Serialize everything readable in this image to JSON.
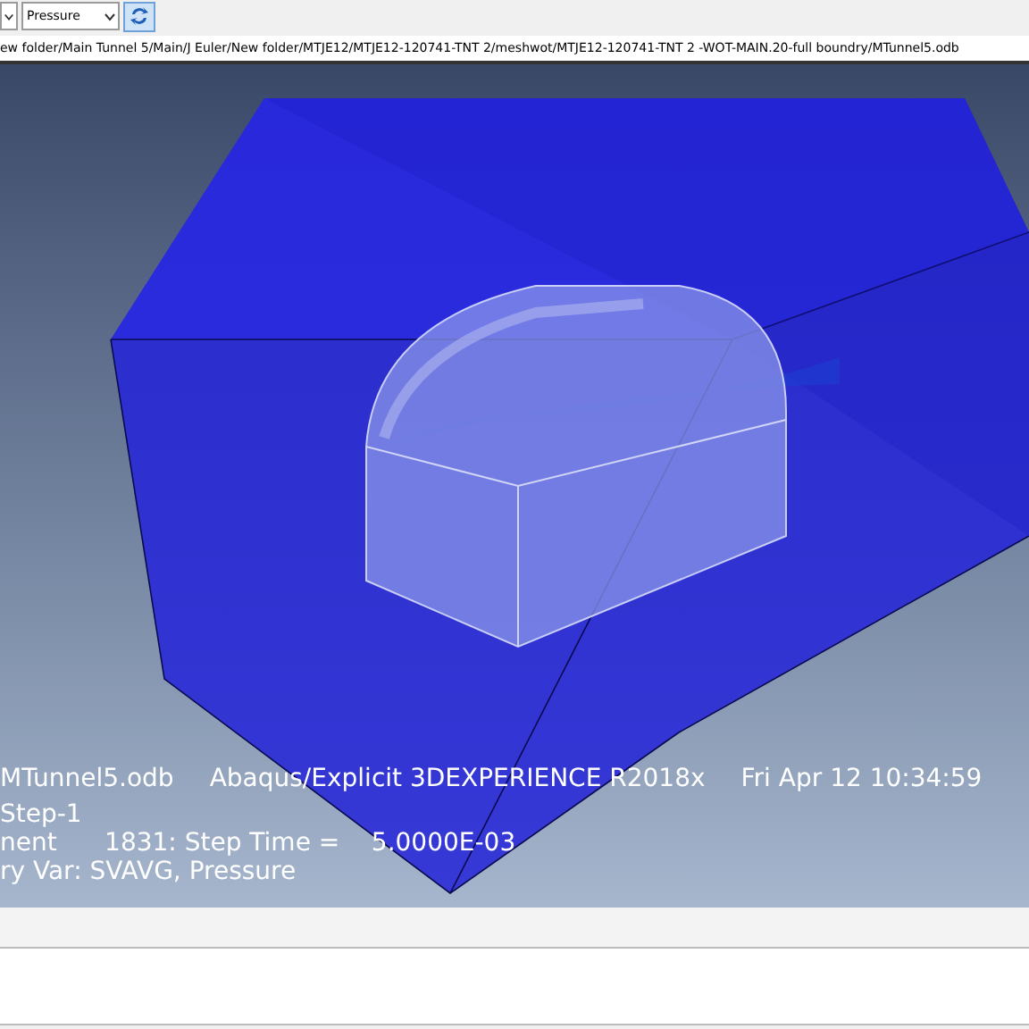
{
  "toolbar": {
    "field_dropdown": {
      "value": "Pressure"
    }
  },
  "path_bar": {
    "value": "ew folder/Main Tunnel 5/Main/J Euler/New folder/MTJE12/MTJE12-120741-TNT 2/meshwot/MTJE12-120741-TNT 2 -WOT-MAIN.20-full boundry/MTunnel5.odb"
  },
  "viewport": {
    "title_line": [
      "MTunnel5.odb",
      "Abaqus/Explicit 3DEXPERIENCE R2018x",
      "Fri Apr 12 10:34:59"
    ],
    "info_lines": [
      "Step-1",
      "nent      1831: Step Time =    5.0000E-03",
      "ry Var: SVAVG, Pressure"
    ]
  }
}
